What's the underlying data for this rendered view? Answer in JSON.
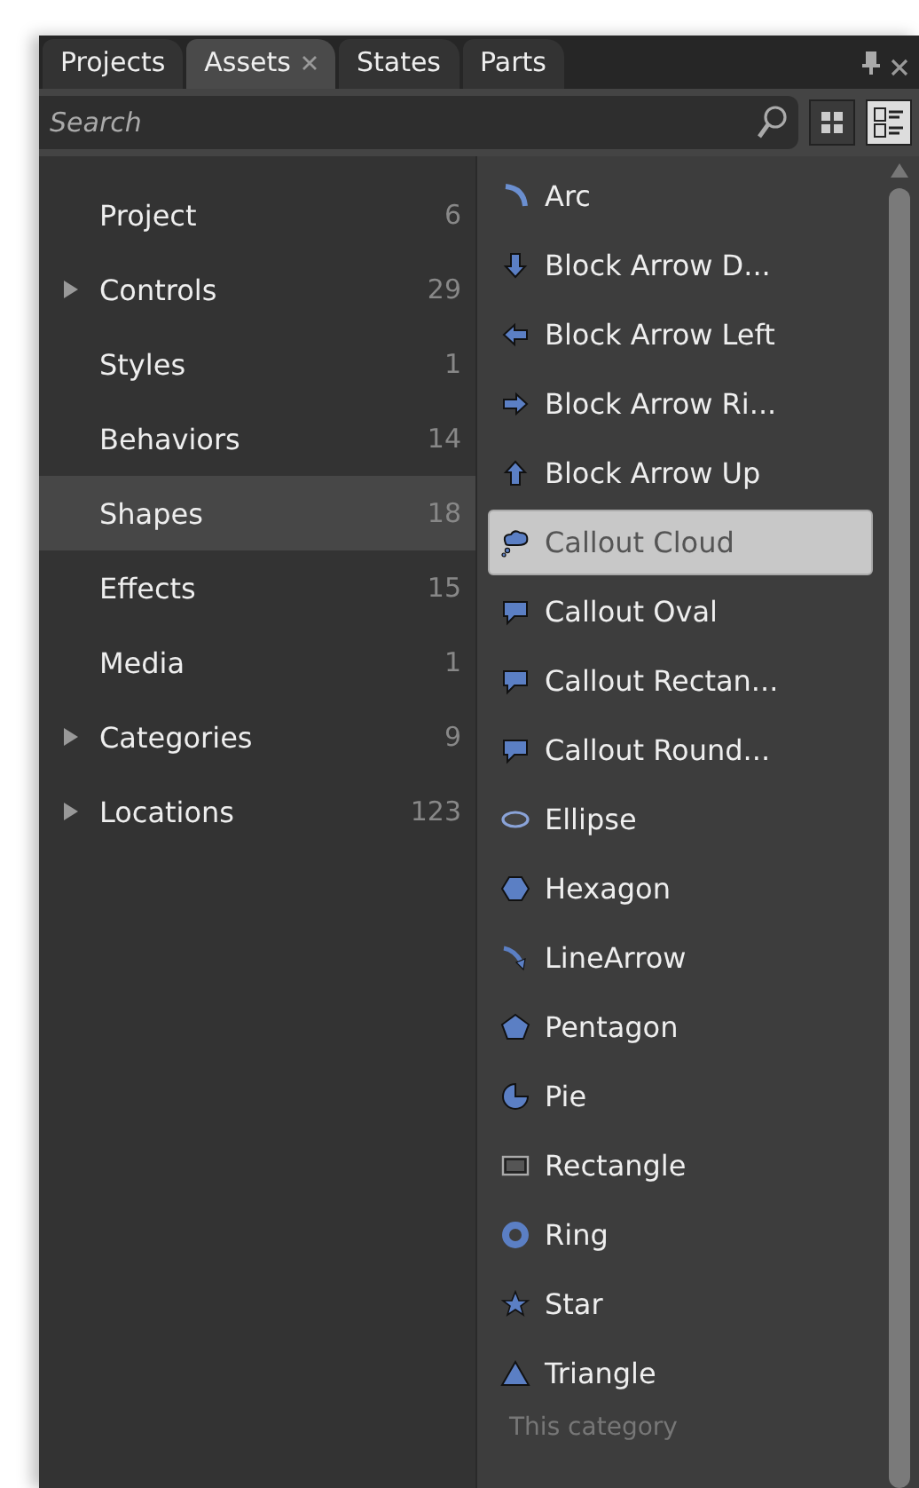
{
  "tabs": [
    {
      "label": "Projects",
      "selected": false,
      "closable": false
    },
    {
      "label": "Assets",
      "selected": true,
      "closable": true
    },
    {
      "label": "States",
      "selected": false,
      "closable": false
    },
    {
      "label": "Parts",
      "selected": false,
      "closable": false
    }
  ],
  "search": {
    "placeholder": "Search"
  },
  "view_buttons": [
    {
      "kind": "grid",
      "selected": false
    },
    {
      "kind": "list",
      "selected": true
    }
  ],
  "categories": [
    {
      "label": "Project",
      "count": "6",
      "expandable": false,
      "selected": false
    },
    {
      "label": "Controls",
      "count": "29",
      "expandable": true,
      "selected": false
    },
    {
      "label": "Styles",
      "count": "1",
      "expandable": false,
      "selected": false
    },
    {
      "label": "Behaviors",
      "count": "14",
      "expandable": false,
      "selected": false
    },
    {
      "label": "Shapes",
      "count": "18",
      "expandable": false,
      "selected": true
    },
    {
      "label": "Effects",
      "count": "15",
      "expandable": false,
      "selected": false
    },
    {
      "label": "Media",
      "count": "1",
      "expandable": false,
      "selected": false
    },
    {
      "label": "Categories",
      "count": "9",
      "expandable": true,
      "selected": false
    },
    {
      "label": "Locations",
      "count": "123",
      "expandable": true,
      "selected": false
    }
  ],
  "assets": [
    {
      "label": "Arc",
      "kind": "arc",
      "selected": false
    },
    {
      "label": "Block Arrow D...",
      "kind": "arrow-down",
      "selected": false
    },
    {
      "label": "Block Arrow Left",
      "kind": "arrow-left",
      "selected": false
    },
    {
      "label": "Block Arrow Ri...",
      "kind": "arrow-right",
      "selected": false
    },
    {
      "label": "Block Arrow Up",
      "kind": "arrow-up",
      "selected": false
    },
    {
      "label": "Callout Cloud",
      "kind": "cloud",
      "selected": true
    },
    {
      "label": "Callout Oval",
      "kind": "callout",
      "selected": false
    },
    {
      "label": "Callout Rectan...",
      "kind": "callout",
      "selected": false
    },
    {
      "label": "Callout Round...",
      "kind": "callout",
      "selected": false
    },
    {
      "label": "Ellipse",
      "kind": "ellipse",
      "selected": false
    },
    {
      "label": "Hexagon",
      "kind": "hexagon",
      "selected": false
    },
    {
      "label": "LineArrow",
      "kind": "line-arrow",
      "selected": false
    },
    {
      "label": "Pentagon",
      "kind": "pentagon",
      "selected": false
    },
    {
      "label": "Pie",
      "kind": "pie",
      "selected": false
    },
    {
      "label": "Rectangle",
      "kind": "rectangle",
      "selected": false
    },
    {
      "label": "Ring",
      "kind": "ring",
      "selected": false
    },
    {
      "label": "Star",
      "kind": "star",
      "selected": false
    },
    {
      "label": "Triangle",
      "kind": "triangle",
      "selected": false
    }
  ],
  "footer_note": "This category"
}
